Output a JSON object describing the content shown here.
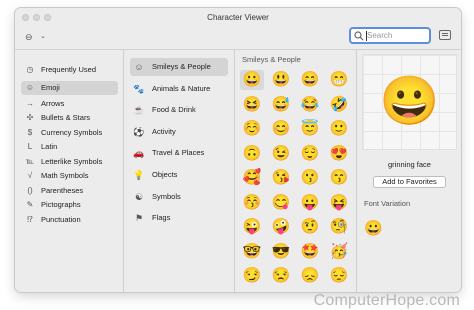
{
  "window": {
    "title": "Character Viewer"
  },
  "toolbar": {
    "search_placeholder": "Search"
  },
  "categories": [
    {
      "icon": "◷",
      "label": "Frequently Used"
    },
    {
      "icon": "☺",
      "label": "Emoji"
    },
    {
      "icon": "→",
      "label": "Arrows"
    },
    {
      "icon": "✣",
      "label": "Bullets & Stars"
    },
    {
      "icon": "$",
      "label": "Currency Symbols"
    },
    {
      "icon": "L",
      "label": "Latin"
    },
    {
      "icon": "℡",
      "label": "Letterlike Symbols"
    },
    {
      "icon": "√",
      "label": "Math Symbols"
    },
    {
      "icon": "()",
      "label": "Parentheses"
    },
    {
      "icon": "✎",
      "label": "Pictographs"
    },
    {
      "icon": "⁉",
      "label": "Punctuation"
    }
  ],
  "subcategories": [
    {
      "icon": "☺",
      "label": "Smileys & People"
    },
    {
      "icon": "🐾",
      "label": "Animals & Nature"
    },
    {
      "icon": "☕",
      "label": "Food & Drink"
    },
    {
      "icon": "⚽",
      "label": "Activity"
    },
    {
      "icon": "🚗",
      "label": "Travel & Places"
    },
    {
      "icon": "💡",
      "label": "Objects"
    },
    {
      "icon": "☯",
      "label": "Symbols"
    },
    {
      "icon": "⚑",
      "label": "Flags"
    }
  ],
  "grid": {
    "title": "Smileys & People",
    "emojis": [
      "😀",
      "😃",
      "😄",
      "😁",
      "😆",
      "😅",
      "😂",
      "🤣",
      "☺️",
      "😊",
      "😇",
      "🙂",
      "🙃",
      "😉",
      "😌",
      "😍",
      "🥰",
      "😘",
      "😗",
      "😙",
      "😚",
      "😋",
      "😛",
      "😝",
      "😜",
      "🤪",
      "🤨",
      "🧐",
      "🤓",
      "😎",
      "🤩",
      "🥳",
      "😏",
      "😒",
      "😞",
      "😔"
    ]
  },
  "detail": {
    "emoji": "😀",
    "name": "grinning face",
    "add_favorites": "Add to Favorites",
    "font_variation_title": "Font Variation",
    "font_variation_emoji": "😀"
  },
  "footer": {
    "brand": "ComputerHope.com"
  }
}
